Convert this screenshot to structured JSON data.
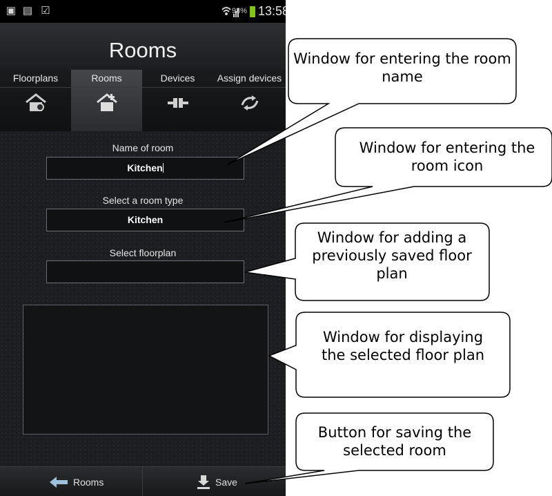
{
  "status_bar": {
    "left_icons": [
      "image-icon",
      "doc-icon",
      "clipboard-icon"
    ],
    "battery_percent": "98%",
    "time": "13:58"
  },
  "title": "Rooms",
  "tabs": [
    {
      "label": "Floorplans",
      "icon": "floorplans-icon",
      "active": false
    },
    {
      "label": "Rooms",
      "icon": "house-add-icon",
      "active": true
    },
    {
      "label": "Devices",
      "icon": "plug-icon",
      "active": false
    },
    {
      "label": "Assign devices",
      "icon": "assign-icon",
      "active": false
    }
  ],
  "form": {
    "name_label": "Name of room",
    "name_value": "Kitchen",
    "type_label": "Select a room type",
    "type_value": "Kitchen",
    "floorplan_label": "Select floorplan",
    "floorplan_value": ""
  },
  "bottom": {
    "back_label": "Rooms",
    "save_label": "Save"
  },
  "callouts": {
    "name_window": "Window for entering the room name",
    "icon_window": "Window for entering the room icon",
    "floorplan_window": "Window for adding a previously saved floor plan",
    "display_window": "Window for displaying the selected floor plan",
    "save_button": "Button for saving the selected room"
  },
  "colors": {
    "battery": "#7fc31c",
    "background": "#1b1d20"
  }
}
